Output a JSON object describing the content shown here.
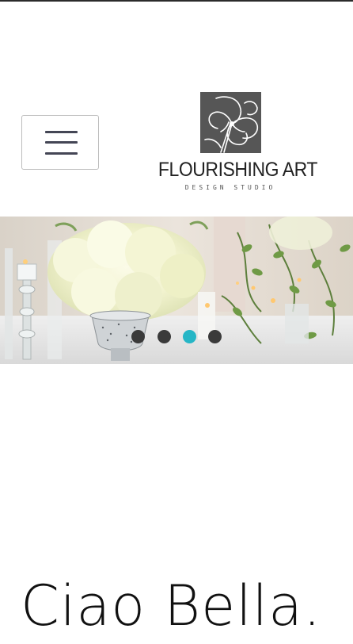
{
  "header": {
    "menu_icon": "hamburger-menu-icon",
    "logo": {
      "name": "FLOURISHING ART",
      "tagline": "DESIGN STUDIO",
      "mark_icon": "flower-logo-mark"
    }
  },
  "hero": {
    "slider_dots": [
      {
        "active": false
      },
      {
        "active": false
      },
      {
        "active": true
      },
      {
        "active": false
      }
    ],
    "active_slide": 3,
    "slide_count": 4,
    "accent_color": "#26b6c6"
  },
  "main": {
    "headline": "Ciao Bella."
  }
}
